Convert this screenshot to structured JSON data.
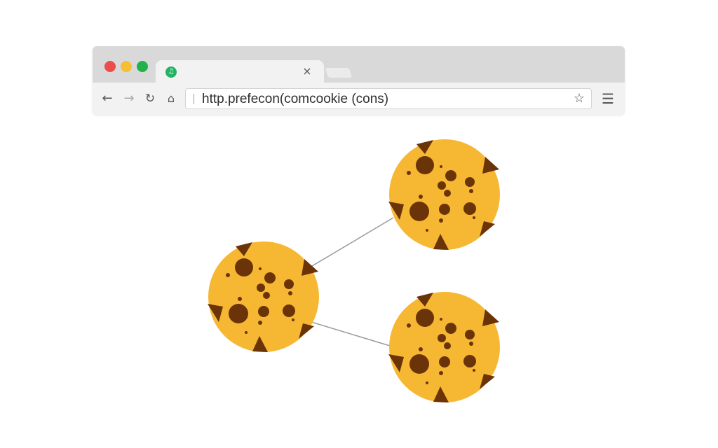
{
  "window": {
    "controls": [
      "close",
      "minimize",
      "maximize"
    ],
    "tab": {
      "favicon_glyph": "♫",
      "close_glyph": "×"
    },
    "toolbar": {
      "back_glyph": "←",
      "forward_glyph": "→",
      "reload_glyph": "↻",
      "home_glyph": "⌂",
      "menu_glyph": "☰"
    },
    "address_bar": {
      "url": "http.prefecon(comcookie (cons)",
      "bookmark_glyph": "☆"
    }
  },
  "content": {
    "cookies": [
      "cookie-left",
      "cookie-top-right",
      "cookie-bottom-right"
    ],
    "cookie_color": "#f6b733",
    "chip_color": "#6b3408",
    "connector_color": "#9a9a9a"
  }
}
